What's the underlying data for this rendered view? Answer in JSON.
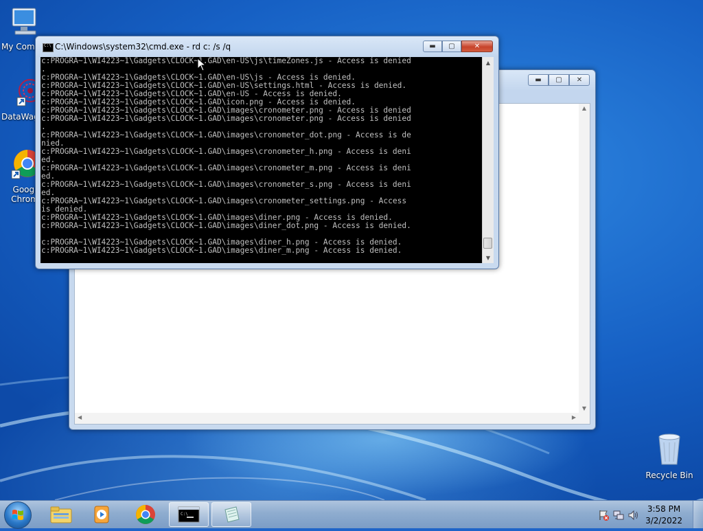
{
  "desktop": {
    "icons": [
      {
        "label": "My Comp",
        "icon": "computer-icon"
      },
      {
        "label": "DataWag",
        "icon": "datawag-app-icon"
      },
      {
        "label": "Googl Chrom",
        "icon": "chrome-icon"
      },
      {
        "label": "Recycle Bin",
        "icon": "recycle-bin-icon"
      }
    ]
  },
  "cmd_window": {
    "title": "C:\\Windows\\system32\\cmd.exe - rd  c: /s /q",
    "lines": [
      "c:PROGRA~1\\WI4223~1\\Gadgets\\CLOCK~1.GAD\\en-US\\js\\timeZones.js - Access is denied",
      ".",
      "c:PROGRA~1\\WI4223~1\\Gadgets\\CLOCK~1.GAD\\en-US\\js - Access is denied.",
      "c:PROGRA~1\\WI4223~1\\Gadgets\\CLOCK~1.GAD\\en-US\\settings.html - Access is denied.",
      "c:PROGRA~1\\WI4223~1\\Gadgets\\CLOCK~1.GAD\\en-US - Access is denied.",
      "c:PROGRA~1\\WI4223~1\\Gadgets\\CLOCK~1.GAD\\icon.png - Access is denied.",
      "c:PROGRA~1\\WI4223~1\\Gadgets\\CLOCK~1.GAD\\images\\cronometer.png - Access is denied",
      "c:PROGRA~1\\WI4223~1\\Gadgets\\CLOCK~1.GAD\\images\\cronometer.png - Access is denied",
      ".",
      "c:PROGRA~1\\WI4223~1\\Gadgets\\CLOCK~1.GAD\\images\\cronometer_dot.png - Access is de",
      "nied.",
      "c:PROGRA~1\\WI4223~1\\Gadgets\\CLOCK~1.GAD\\images\\cronometer_h.png - Access is deni",
      "ed.",
      "c:PROGRA~1\\WI4223~1\\Gadgets\\CLOCK~1.GAD\\images\\cronometer_m.png - Access is deni",
      "ed.",
      "c:PROGRA~1\\WI4223~1\\Gadgets\\CLOCK~1.GAD\\images\\cronometer_s.png - Access is deni",
      "ed.",
      "c:PROGRA~1\\WI4223~1\\Gadgets\\CLOCK~1.GAD\\images\\cronometer_settings.png - Access",
      "is denied.",
      "c:PROGRA~1\\WI4223~1\\Gadgets\\CLOCK~1.GAD\\images\\diner.png - Access is denied.",
      "c:PROGRA~1\\WI4223~1\\Gadgets\\CLOCK~1.GAD\\images\\diner_dot.png - Access is denied.",
      "",
      "c:PROGRA~1\\WI4223~1\\Gadgets\\CLOCK~1.GAD\\images\\diner_h.png - Access is denied.",
      "c:PROGRA~1\\WI4223~1\\Gadgets\\CLOCK~1.GAD\\images\\diner_m.png - Access is denied."
    ]
  },
  "taskbar": {
    "pinned": [
      "start-orb",
      "explorer-icon",
      "media-player-icon",
      "chrome-icon",
      "cmd-icon",
      "notepad-icon"
    ],
    "clock_time": "3:58 PM",
    "clock_date": "3/2/2022"
  }
}
